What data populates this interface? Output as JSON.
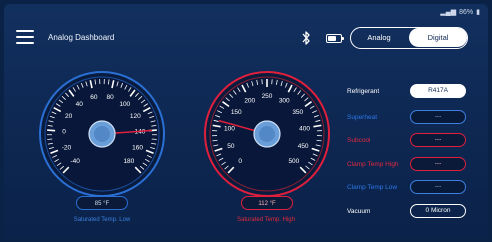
{
  "status_bar": {
    "text": "86%"
  },
  "header": {
    "title": "Analog Dashboard"
  },
  "mode_toggle": {
    "analog_label": "Analog",
    "digital_label": "Digital",
    "selected": "Digital"
  },
  "gauges": [
    {
      "ticks": [
        "-40",
        "-20",
        "0",
        "20",
        "40",
        "60",
        "80",
        "100",
        "120",
        "140",
        "160",
        "180"
      ],
      "scale": [
        -40,
        180
      ],
      "needle_value": 140,
      "readout": "85 °F",
      "caption": "Saturated Temp. Low",
      "color": "#2a6fd4"
    },
    {
      "ticks": [
        "0",
        "50",
        "100",
        "150",
        "200",
        "250",
        "300",
        "350",
        "400",
        "450",
        "500"
      ],
      "scale": [
        0,
        500
      ],
      "needle_value": 112,
      "readout": "112 °F",
      "caption": "Saturated Temp. High",
      "color": "#e01f3c"
    }
  ],
  "fields": {
    "refrigerant": {
      "label": "Refrigerant",
      "value": "R417A"
    },
    "superheat": {
      "label": "Superheat",
      "value": "---"
    },
    "subcool": {
      "label": "Subcool",
      "value": "---"
    },
    "clamp_high": {
      "label": "Clamp Temp High",
      "value": "---"
    },
    "clamp_low": {
      "label": "Clamp Temp Low",
      "value": "---"
    },
    "vacuum": {
      "label": "Vacuum",
      "value": "0 Micron"
    }
  },
  "colors": {
    "accent_blue": "#2a6fd4",
    "accent_red": "#e01f3c",
    "background": "#0f2a56"
  }
}
